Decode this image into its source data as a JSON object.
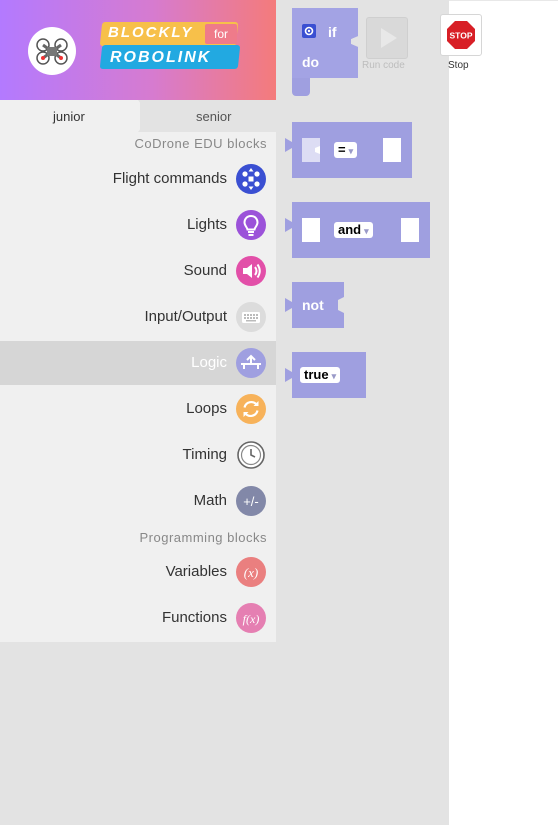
{
  "header": {
    "logo_top": "BLOCKLY",
    "logo_for": "for",
    "logo_bottom": "ROBOLINK"
  },
  "tabs": [
    {
      "label": "junior",
      "active": true
    },
    {
      "label": "senior",
      "active": false
    }
  ],
  "sections": {
    "codrone": "CoDrone EDU blocks",
    "programming": "Programming blocks"
  },
  "categories": [
    {
      "label": "Flight commands",
      "icon": "drone-icon",
      "color": "#3a4fd2"
    },
    {
      "label": "Lights",
      "icon": "lightbulb-icon",
      "color": "#9b52d9"
    },
    {
      "label": "Sound",
      "icon": "speaker-icon",
      "color": "#e24fa8"
    },
    {
      "label": "Input/Output",
      "icon": "keyboard-icon",
      "color": "#dcdcdc"
    },
    {
      "label": "Logic",
      "icon": "logic-icon",
      "color": "#9f9fe0",
      "selected": true
    },
    {
      "label": "Loops",
      "icon": "loop-icon",
      "color": "#f7b25a"
    },
    {
      "label": "Timing",
      "icon": "clock-icon",
      "color": "#f0f0f0"
    },
    {
      "label": "Math",
      "icon": "plus-minus-icon",
      "color": "#8288a8",
      "glyph": "+/-"
    },
    {
      "label": "Variables",
      "icon": "variable-icon",
      "color": "#ea7f7f",
      "glyph": "(x)"
    },
    {
      "label": "Functions",
      "icon": "function-icon",
      "color": "#e57fb2",
      "glyph": "f(x)"
    }
  ],
  "toolbar": {
    "run_label": "Run code",
    "stop_label": "Stop",
    "stop_sign": "STOP"
  },
  "blocks": {
    "if_label": "if",
    "do_label": "do",
    "compare_op": "=",
    "logic_op": "and",
    "not_label": "not",
    "bool_value": "true",
    "color": "#9f9fe0"
  }
}
